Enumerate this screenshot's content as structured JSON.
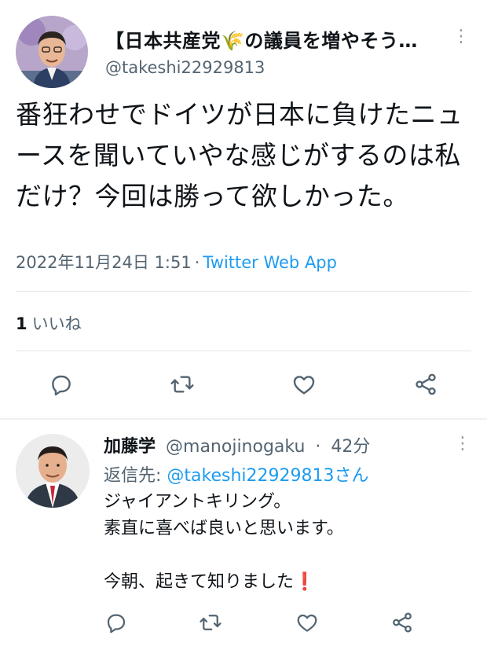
{
  "tweet": {
    "display_name": "【日本共産党🌾の議員を増やそう…",
    "handle": "@takeshi22929813",
    "text": "番狂わせでドイツが日本に負けたニュースを聞いていやな感じがするのは私だけ？今回は勝って欲しかった。",
    "timestamp": "2022年11月24日 1:51",
    "separator": "·",
    "source": "Twitter Web App",
    "like_count": "1",
    "like_label": "いいね",
    "more_icon": "⋮"
  },
  "reply": {
    "display_name": "加藤学",
    "handle": "@manojinogaku",
    "separator": "·",
    "time_ago": "42分",
    "reply_prefix": "返信先: ",
    "reply_to": "@takeshi22929813さん",
    "line1": "ジャイアントキリング。",
    "line2": "素直に喜べば良いと思います。",
    "line3": "今朝、起きて知りました",
    "line3_emoji": "❗",
    "more_icon": "⋮"
  },
  "icons": {
    "reply": "reply-icon",
    "retweet": "retweet-icon",
    "like": "heart-icon",
    "share": "share-icon"
  },
  "colors": {
    "accent": "#1d9bf0",
    "text": "#0f1419",
    "muted": "#536471",
    "divider": "#e1e6ea"
  }
}
